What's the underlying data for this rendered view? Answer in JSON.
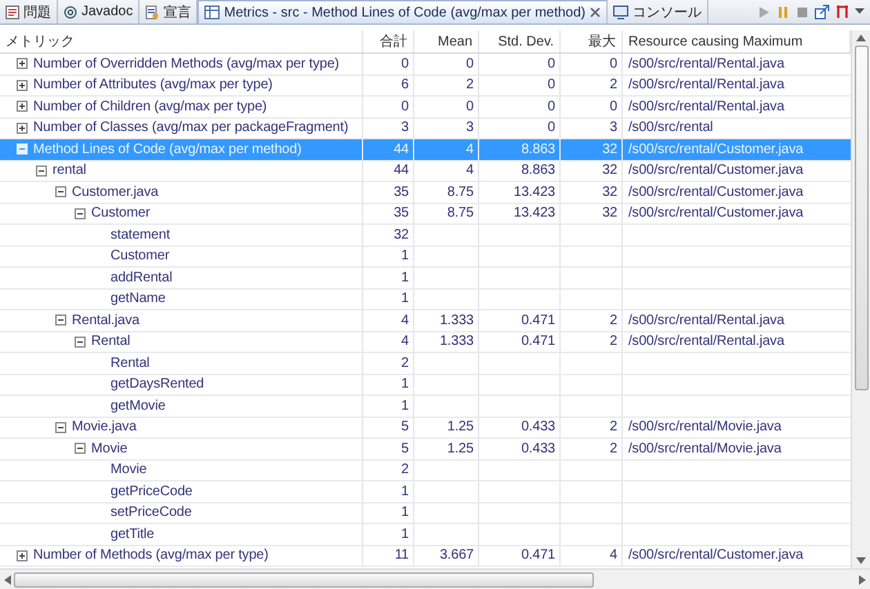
{
  "tabs": [
    {
      "label": "問題",
      "kind": "problems",
      "selected": false
    },
    {
      "label": "Javadoc",
      "kind": "javadoc",
      "selected": false
    },
    {
      "label": "宣言",
      "kind": "declaration",
      "selected": false
    },
    {
      "label": "Metrics - src - Method Lines of Code (avg/max per method)",
      "kind": "metrics",
      "selected": true,
      "closable": true
    },
    {
      "label": "コンソール",
      "kind": "console",
      "selected": false
    }
  ],
  "table": {
    "columns": [
      "メトリック",
      "合計",
      "Mean",
      "Std. Dev.",
      "最大",
      "Resource causing Maximum"
    ],
    "rows": [
      {
        "label": "Number of Overridden Methods (avg/max per type)",
        "total": "0",
        "mean": "0",
        "std_dev": "0",
        "max": "0",
        "resource": "/s00/src/rental/Rental.java",
        "expanded": false,
        "selected": false
      },
      {
        "label": "Number of Attributes (avg/max per type)",
        "total": "6",
        "mean": "2",
        "std_dev": "0",
        "max": "2",
        "resource": "/s00/src/rental/Rental.java",
        "expanded": false,
        "selected": false
      },
      {
        "label": "Number of Children (avg/max per type)",
        "total": "0",
        "mean": "0",
        "std_dev": "0",
        "max": "0",
        "resource": "/s00/src/rental/Rental.java",
        "expanded": false,
        "selected": false
      },
      {
        "label": "Number of Classes (avg/max per packageFragment)",
        "total": "3",
        "mean": "3",
        "std_dev": "0",
        "max": "3",
        "resource": "/s00/src/rental",
        "expanded": false,
        "selected": false
      },
      {
        "label": "Method Lines of Code (avg/max per method)",
        "total": "44",
        "mean": "4",
        "std_dev": "8.863",
        "max": "32",
        "resource": "/s00/src/rental/Customer.java",
        "expanded": true,
        "selected": true,
        "children": [
          {
            "label": "rental",
            "total": "44",
            "mean": "4",
            "std_dev": "8.863",
            "max": "32",
            "resource": "/s00/src/rental/Customer.java",
            "expanded": true,
            "selected": false,
            "children": [
              {
                "label": "Customer.java",
                "total": "35",
                "mean": "8.75",
                "std_dev": "13.423",
                "max": "32",
                "resource": "/s00/src/rental/Customer.java",
                "expanded": true,
                "selected": false,
                "children": [
                  {
                    "label": "Customer",
                    "total": "35",
                    "mean": "8.75",
                    "std_dev": "13.423",
                    "max": "32",
                    "resource": "/s00/src/rental/Customer.java",
                    "expanded": true,
                    "selected": false,
                    "children": [
                      {
                        "label": "statement",
                        "total": "32",
                        "selected": false
                      },
                      {
                        "label": "Customer",
                        "total": "1",
                        "selected": false
                      },
                      {
                        "label": "addRental",
                        "total": "1",
                        "selected": false
                      },
                      {
                        "label": "getName",
                        "total": "1",
                        "selected": false
                      }
                    ]
                  }
                ]
              },
              {
                "label": "Rental.java",
                "total": "4",
                "mean": "1.333",
                "std_dev": "0.471",
                "max": "2",
                "resource": "/s00/src/rental/Rental.java",
                "expanded": true,
                "selected": false,
                "children": [
                  {
                    "label": "Rental",
                    "total": "4",
                    "mean": "1.333",
                    "std_dev": "0.471",
                    "max": "2",
                    "resource": "/s00/src/rental/Rental.java",
                    "expanded": true,
                    "selected": false,
                    "children": [
                      {
                        "label": "Rental",
                        "total": "2",
                        "selected": false
                      },
                      {
                        "label": "getDaysRented",
                        "total": "1",
                        "selected": false
                      },
                      {
                        "label": "getMovie",
                        "total": "1",
                        "selected": false
                      }
                    ]
                  }
                ]
              },
              {
                "label": "Movie.java",
                "total": "5",
                "mean": "1.25",
                "std_dev": "0.433",
                "max": "2",
                "resource": "/s00/src/rental/Movie.java",
                "expanded": true,
                "selected": false,
                "children": [
                  {
                    "label": "Movie",
                    "total": "5",
                    "mean": "1.25",
                    "std_dev": "0.433",
                    "max": "2",
                    "resource": "/s00/src/rental/Movie.java",
                    "expanded": true,
                    "selected": false,
                    "children": [
                      {
                        "label": "Movie",
                        "total": "2",
                        "selected": false
                      },
                      {
                        "label": "getPriceCode",
                        "total": "1",
                        "selected": false
                      },
                      {
                        "label": "setPriceCode",
                        "total": "1",
                        "selected": false
                      },
                      {
                        "label": "getTitle",
                        "total": "1",
                        "selected": false
                      }
                    ]
                  }
                ]
              }
            ]
          }
        ]
      },
      {
        "label": "Number of Methods (avg/max per type)",
        "total": "11",
        "mean": "3.667",
        "std_dev": "0.471",
        "max": "4",
        "resource": "/s00/src/rental/Customer.java",
        "expanded": false,
        "selected": false
      }
    ]
  }
}
